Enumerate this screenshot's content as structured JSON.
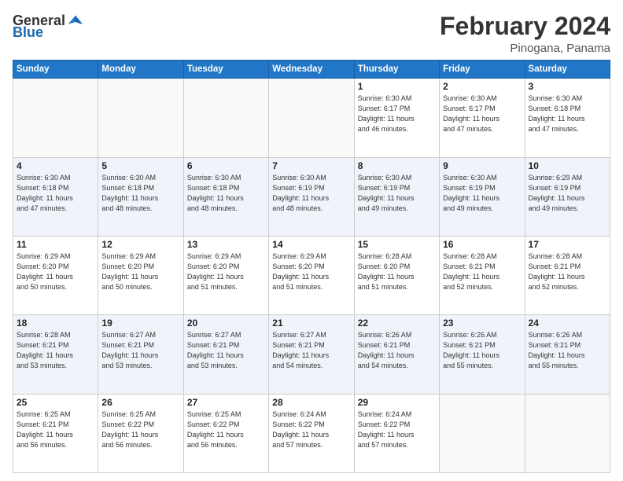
{
  "header": {
    "logo_general": "General",
    "logo_blue": "Blue",
    "month": "February 2024",
    "location": "Pinogana, Panama"
  },
  "days_of_week": [
    "Sunday",
    "Monday",
    "Tuesday",
    "Wednesday",
    "Thursday",
    "Friday",
    "Saturday"
  ],
  "weeks": [
    [
      {
        "day": "",
        "info": ""
      },
      {
        "day": "",
        "info": ""
      },
      {
        "day": "",
        "info": ""
      },
      {
        "day": "",
        "info": ""
      },
      {
        "day": "1",
        "info": "Sunrise: 6:30 AM\nSunset: 6:17 PM\nDaylight: 11 hours\nand 46 minutes."
      },
      {
        "day": "2",
        "info": "Sunrise: 6:30 AM\nSunset: 6:17 PM\nDaylight: 11 hours\nand 47 minutes."
      },
      {
        "day": "3",
        "info": "Sunrise: 6:30 AM\nSunset: 6:18 PM\nDaylight: 11 hours\nand 47 minutes."
      }
    ],
    [
      {
        "day": "4",
        "info": "Sunrise: 6:30 AM\nSunset: 6:18 PM\nDaylight: 11 hours\nand 47 minutes."
      },
      {
        "day": "5",
        "info": "Sunrise: 6:30 AM\nSunset: 6:18 PM\nDaylight: 11 hours\nand 48 minutes."
      },
      {
        "day": "6",
        "info": "Sunrise: 6:30 AM\nSunset: 6:18 PM\nDaylight: 11 hours\nand 48 minutes."
      },
      {
        "day": "7",
        "info": "Sunrise: 6:30 AM\nSunset: 6:19 PM\nDaylight: 11 hours\nand 48 minutes."
      },
      {
        "day": "8",
        "info": "Sunrise: 6:30 AM\nSunset: 6:19 PM\nDaylight: 11 hours\nand 49 minutes."
      },
      {
        "day": "9",
        "info": "Sunrise: 6:30 AM\nSunset: 6:19 PM\nDaylight: 11 hours\nand 49 minutes."
      },
      {
        "day": "10",
        "info": "Sunrise: 6:29 AM\nSunset: 6:19 PM\nDaylight: 11 hours\nand 49 minutes."
      }
    ],
    [
      {
        "day": "11",
        "info": "Sunrise: 6:29 AM\nSunset: 6:20 PM\nDaylight: 11 hours\nand 50 minutes."
      },
      {
        "day": "12",
        "info": "Sunrise: 6:29 AM\nSunset: 6:20 PM\nDaylight: 11 hours\nand 50 minutes."
      },
      {
        "day": "13",
        "info": "Sunrise: 6:29 AM\nSunset: 6:20 PM\nDaylight: 11 hours\nand 51 minutes."
      },
      {
        "day": "14",
        "info": "Sunrise: 6:29 AM\nSunset: 6:20 PM\nDaylight: 11 hours\nand 51 minutes."
      },
      {
        "day": "15",
        "info": "Sunrise: 6:28 AM\nSunset: 6:20 PM\nDaylight: 11 hours\nand 51 minutes."
      },
      {
        "day": "16",
        "info": "Sunrise: 6:28 AM\nSunset: 6:21 PM\nDaylight: 11 hours\nand 52 minutes."
      },
      {
        "day": "17",
        "info": "Sunrise: 6:28 AM\nSunset: 6:21 PM\nDaylight: 11 hours\nand 52 minutes."
      }
    ],
    [
      {
        "day": "18",
        "info": "Sunrise: 6:28 AM\nSunset: 6:21 PM\nDaylight: 11 hours\nand 53 minutes."
      },
      {
        "day": "19",
        "info": "Sunrise: 6:27 AM\nSunset: 6:21 PM\nDaylight: 11 hours\nand 53 minutes."
      },
      {
        "day": "20",
        "info": "Sunrise: 6:27 AM\nSunset: 6:21 PM\nDaylight: 11 hours\nand 53 minutes."
      },
      {
        "day": "21",
        "info": "Sunrise: 6:27 AM\nSunset: 6:21 PM\nDaylight: 11 hours\nand 54 minutes."
      },
      {
        "day": "22",
        "info": "Sunrise: 6:26 AM\nSunset: 6:21 PM\nDaylight: 11 hours\nand 54 minutes."
      },
      {
        "day": "23",
        "info": "Sunrise: 6:26 AM\nSunset: 6:21 PM\nDaylight: 11 hours\nand 55 minutes."
      },
      {
        "day": "24",
        "info": "Sunrise: 6:26 AM\nSunset: 6:21 PM\nDaylight: 11 hours\nand 55 minutes."
      }
    ],
    [
      {
        "day": "25",
        "info": "Sunrise: 6:25 AM\nSunset: 6:21 PM\nDaylight: 11 hours\nand 56 minutes."
      },
      {
        "day": "26",
        "info": "Sunrise: 6:25 AM\nSunset: 6:22 PM\nDaylight: 11 hours\nand 56 minutes."
      },
      {
        "day": "27",
        "info": "Sunrise: 6:25 AM\nSunset: 6:22 PM\nDaylight: 11 hours\nand 56 minutes."
      },
      {
        "day": "28",
        "info": "Sunrise: 6:24 AM\nSunset: 6:22 PM\nDaylight: 11 hours\nand 57 minutes."
      },
      {
        "day": "29",
        "info": "Sunrise: 6:24 AM\nSunset: 6:22 PM\nDaylight: 11 hours\nand 57 minutes."
      },
      {
        "day": "",
        "info": ""
      },
      {
        "day": "",
        "info": ""
      }
    ]
  ]
}
